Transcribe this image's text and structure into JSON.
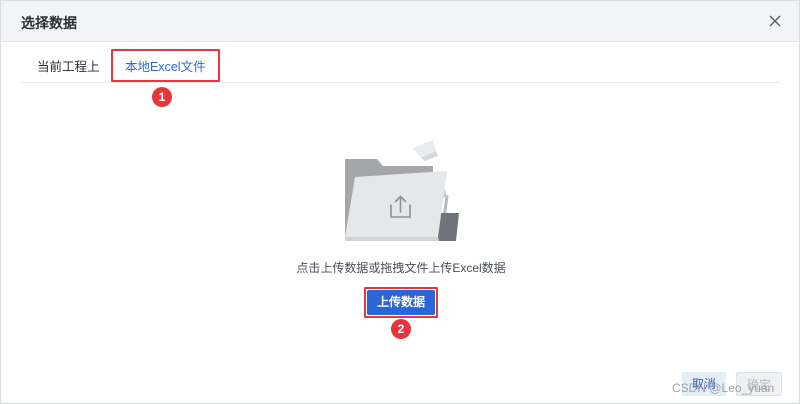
{
  "dialog": {
    "title": "选择数据"
  },
  "tabs": [
    {
      "label": "当前工程上"
    },
    {
      "label": "本地Excel文件"
    }
  ],
  "annotations": {
    "badge_1": "1",
    "badge_2": "2",
    "highlight_color": "#e8373b"
  },
  "upload": {
    "hint": "点击上传数据或拖拽文件上传Excel数据",
    "button_label": "上传数据"
  },
  "footer": {
    "cancel_label": "取消",
    "confirm_label": "确定"
  },
  "watermark": "CSDN @Leo_yuan",
  "colors": {
    "accent": "#2b66d9",
    "annotation_red": "#e6363a",
    "header_bg": "#f3f4f8"
  },
  "icons": {
    "close": "close-icon",
    "illustration": "folder-upload-illustration"
  }
}
